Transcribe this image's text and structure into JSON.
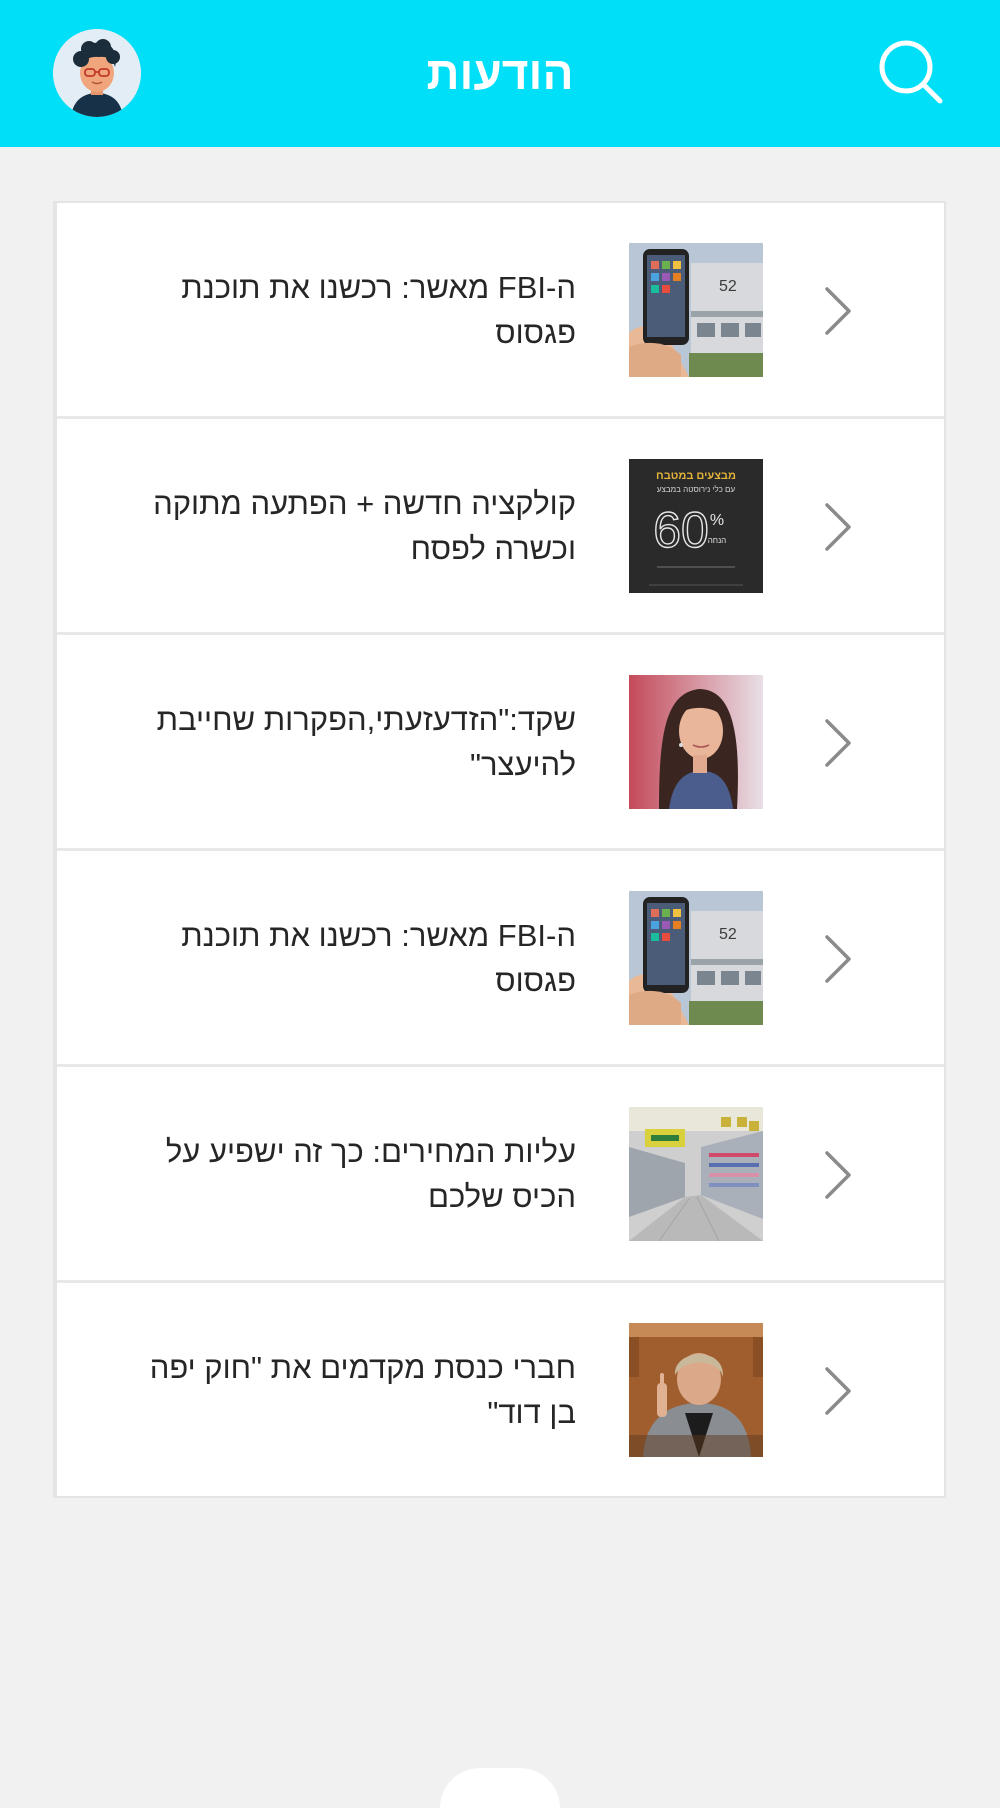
{
  "header": {
    "title": "הודעות",
    "background_color": "#00dff8",
    "search_icon": "search-icon",
    "avatar_icon": "user-avatar"
  },
  "messages": [
    {
      "text": "ה-FBI מאשר: רכשנו את תוכנת פגסוס",
      "thumbnail": "phone-building-photo"
    },
    {
      "text": "קולקציה חדשה + הפתעה מתוקה וכשרה לפסח",
      "thumbnail": "sale-60-percent-ad",
      "thumbnail_text": {
        "line1": "מבצעים במטבח",
        "line2": "עם כלי נירוסטה במבצע",
        "big": "60",
        "pct": "%",
        "small": "הנחה"
      }
    },
    {
      "text": "שקד:\"הזדעזעתי,הפקרות שחייבת להיעצר\"",
      "thumbnail": "woman-portrait-photo"
    },
    {
      "text": "ה-FBI מאשר: רכשנו את תוכנת פגסוס",
      "thumbnail": "phone-building-photo"
    },
    {
      "text": "עליות המחירים: כך זה ישפיע על הכיס שלכם",
      "thumbnail": "supermarket-aisle-photo"
    },
    {
      "text": "חברי כנסת מקדמים את \"חוק יפה בן דוד\"",
      "thumbnail": "speaker-podium-photo"
    }
  ],
  "chevron_icon": "chevron-right-icon"
}
